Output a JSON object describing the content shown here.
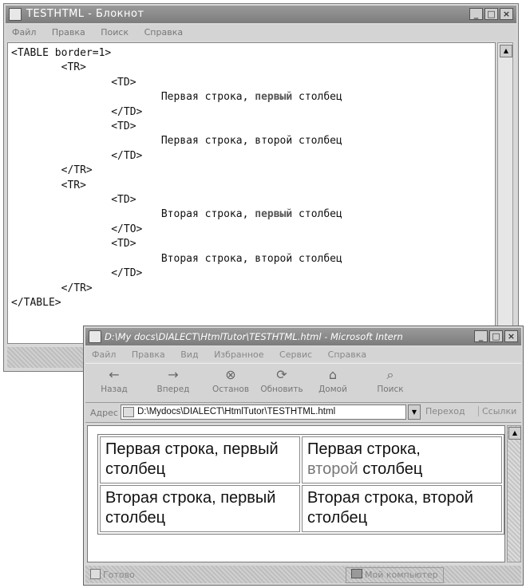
{
  "notepad": {
    "title": "TESTHTML - Блокнот",
    "menu": [
      "Файл",
      "Правка",
      "Поиск",
      "Справка"
    ],
    "code": {
      "line1": "<TABLE border=1>",
      "line2": "        <TR>",
      "line3": "                <TD>",
      "line4_pre": "                        Первая строка, ",
      "line4_hl": "первый",
      "line4_post": " столбец",
      "line5": "                </TD>",
      "line6": "                <TD>",
      "line7": "                        Первая строка, второй столбец",
      "line8": "                </TD>",
      "line9": "        </TR>",
      "line10": "        <TR>",
      "line11": "                <TD>",
      "line12_pre": "                        Вторая строка, ",
      "line12_hl": "первый",
      "line12_post": " столбец",
      "line13": "                </TO>",
      "line14": "                <TD>",
      "line15": "                        Вторая строка, второй столбец",
      "line16": "                </TD>",
      "line17": "        </TR>",
      "line18": "</TABLE>"
    }
  },
  "browser": {
    "title": "D:\\My docs\\DIALECT\\HtmlTutor\\TESTHTML.html - Microsoft Intern",
    "menu": [
      "Файл",
      "Правка",
      "Вид",
      "Избранное",
      "Сервис",
      "Справка"
    ],
    "toolbar": {
      "back": "Назад",
      "forward": "Вперед",
      "stop": "Останов",
      "refresh": "Обновить",
      "home": "Домой",
      "search": "Поиск"
    },
    "address_label": "Адрес",
    "address_value": "D:\\Mydocs\\DIALECT\\HtmlTutor\\TESTHTML.html",
    "go_label": "Переход",
    "links_label": "Ссылки",
    "table": {
      "r1c1": "Первая строка, первый столбец",
      "r1c2_line1": "Первая строка,",
      "r1c2_word": "второй",
      "r1c2_rest": " столбец",
      "r2c1": "Вторая строка, первый столбец",
      "r2c2": "Вторая строка, второй столбец"
    },
    "status_ready": "Готово",
    "status_zone": "Мой компьютер"
  }
}
